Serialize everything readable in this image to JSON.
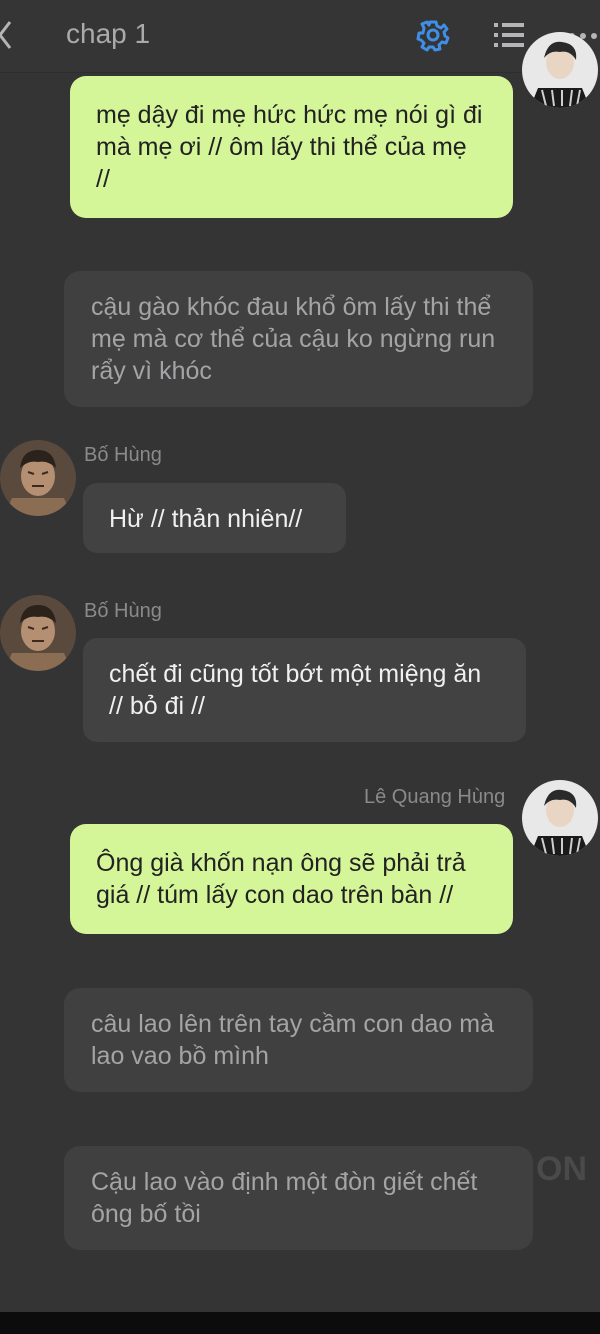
{
  "header": {
    "title": "chap 1"
  },
  "messages": {
    "m1": {
      "text": "mẹ dậy đi mẹ hức hức mẹ nói gì đi mà mẹ ơi // ôm lấy thi thể của mẹ //"
    },
    "n1": {
      "text": "cậu gào khóc đau khổ ôm lấy thi thể mẹ mà cơ thể của cậu ko ngừng run rẩy vì khóc"
    },
    "m2": {
      "sender": "Bố Hùng",
      "text": "Hừ // thản nhiên//"
    },
    "m3": {
      "sender": "Bố Hùng",
      "text": "chết đi cũng tốt bớt một miệng ăn // bỏ đi //"
    },
    "m4": {
      "sender": "Lê Quang Hùng",
      "text": "Ông già khốn nạn ông sẽ phải trả giá // túm lấy con dao trên bàn //"
    },
    "n2": {
      "text": "câu lao lên trên tay cầm con dao mà lao vao bồ mình"
    },
    "n3": {
      "text": "Cậu lao vào định một đòn giết chết ông bố tồi"
    }
  },
  "colors": {
    "accent": "#3f8fe6",
    "user_bubble": "#d4f598",
    "background": "#343435"
  },
  "icons": [
    "back-icon",
    "gear-icon",
    "list-icon",
    "more-icon"
  ]
}
